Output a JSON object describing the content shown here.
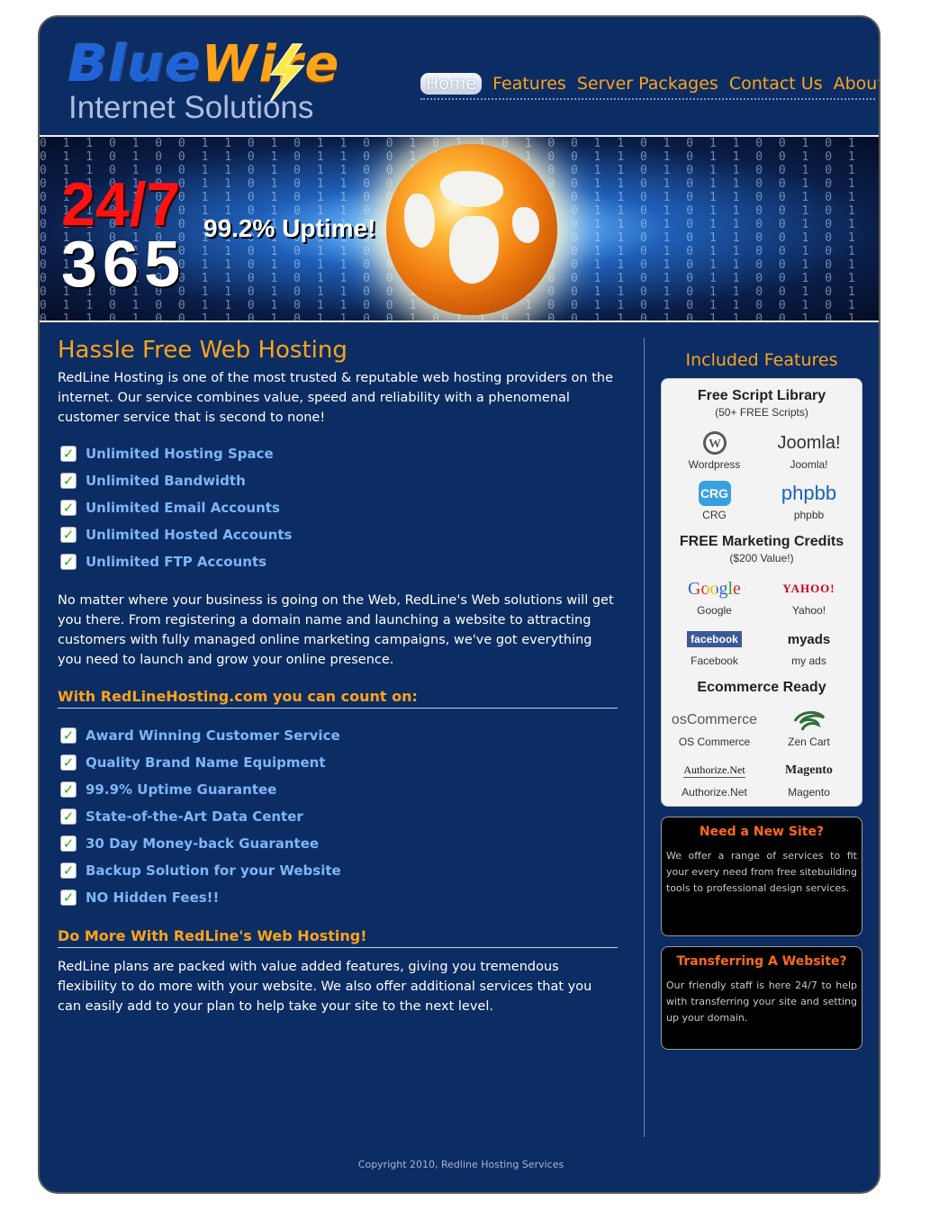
{
  "brand": {
    "logo_word1": "Blue",
    "logo_word2": "Wire",
    "logo_tagline": "Internet Solutions"
  },
  "nav": [
    {
      "label": "Home",
      "active": true
    },
    {
      "label": "Features",
      "active": false
    },
    {
      "label": "Server Packages",
      "active": false
    },
    {
      "label": "Contact Us",
      "active": false
    },
    {
      "label": "About Us",
      "active": false
    }
  ],
  "banner": {
    "big_red": "24/7",
    "big_white": "365",
    "uptime": "99.2% Uptime!"
  },
  "main": {
    "title": "Hassle Free Web Hosting",
    "intro": "RedLine Hosting is one of the most trusted & reputable web hosting providers on the internet. Our service combines value, speed and reliability with a phenomenal customer service that is second to none!",
    "features": [
      "Unlimited Hosting Space",
      "Unlimited Bandwidth",
      "Unlimited Email Accounts",
      "Unlimited Hosted Accounts",
      "Unlimited FTP Accounts"
    ],
    "para2": "No matter where your business is going on the Web, RedLine's Web solutions will get you there. From registering a domain name and launching a website to attracting customers with fully managed online marketing campaigns, we've got everything you need to launch and grow your online presence.",
    "count_heading": "With RedLineHosting.com you can count on:",
    "count_items": [
      "Award Winning Customer Service",
      "Quality Brand Name Equipment",
      "99.9% Uptime Guarantee",
      "State-of-the-Art Data Center",
      "30 Day Money-back Guarantee",
      "Backup Solution for your Website",
      "NO Hidden Fees!!"
    ],
    "more_heading": "Do More With RedLine's Web Hosting!",
    "more_text": "RedLine plans are packed with value added features, giving you tremendous flexibility to do more with your website. We also offer additional services that you can easily add to your plan to help take your site to the next level."
  },
  "sidebar": {
    "title": "Included Features",
    "script_lib": {
      "heading": "Free Script Library",
      "sub": "(50+ FREE Scripts)",
      "items": [
        "Wordpress",
        "Joomla!",
        "CRG",
        "phpbb"
      ],
      "logos": [
        "W",
        "Joomla!",
        "CRG",
        "phpbb"
      ]
    },
    "marketing": {
      "heading": "FREE Marketing Credits",
      "sub": "($200 Value!)",
      "items": [
        "Google",
        "Yahoo!",
        "Facebook",
        "my ads"
      ],
      "logos": [
        "Google",
        "YAHOO!",
        "facebook",
        "myads"
      ]
    },
    "ecommerce": {
      "heading": "Ecommerce Ready",
      "items": [
        "OS Commerce",
        "Zen Cart",
        "Authorize.Net",
        "Magento"
      ],
      "logos": [
        "osCommerce",
        "Zen",
        "Authorize.Net",
        "Magento"
      ]
    },
    "new_site": {
      "title": "Need a New Site?",
      "text": "We offer a range of services to fit your every need from free sitebuilding tools to professional design services."
    },
    "transfer": {
      "title": "Transferring A Website?",
      "text": "Our friendly staff is here 24/7 to help with transferring your site and setting up your domain."
    }
  },
  "footer": {
    "copyright": "Copyright 2010, Redline Hosting Services"
  },
  "colors": {
    "page_bg": "#0b2d63",
    "accent": "#ffa31a",
    "link": "#7fb5f5",
    "banner_red": "#ff1212"
  }
}
